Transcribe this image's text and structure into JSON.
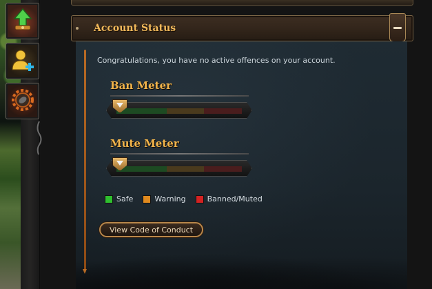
{
  "sidebar": {
    "buttons": [
      {
        "name": "level-up-icon"
      },
      {
        "name": "add-friend-icon"
      },
      {
        "name": "settings-gear-icon"
      }
    ]
  },
  "section": {
    "title": "Account Status",
    "collapse_icon": "minus-icon"
  },
  "status": {
    "message": "Congratulations, you have no active offences on your account."
  },
  "meters": [
    {
      "title": "Ban Meter",
      "level": 0
    },
    {
      "title": "Mute Meter",
      "level": 0
    }
  ],
  "legend": [
    {
      "label": "Safe",
      "color": "#2fbf2f"
    },
    {
      "label": "Warning",
      "color": "#e08a1e"
    },
    {
      "label": "Banned/Muted",
      "color": "#d42222"
    }
  ],
  "conduct_button": {
    "label": "View Code of Conduct"
  },
  "colors": {
    "accent_gold": "#f2b44a",
    "panel_bg": "#1b252c"
  }
}
